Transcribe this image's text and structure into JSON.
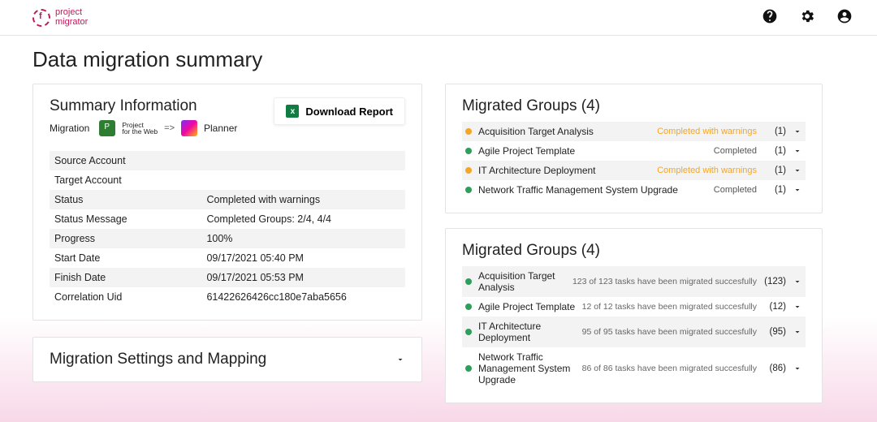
{
  "brand": {
    "line1": "project",
    "line2": "migrator"
  },
  "pageTitle": "Data migration summary",
  "summary": {
    "title": "Summary Information",
    "downloadLabel": "Download Report",
    "migrationLabel": "Migration",
    "sourceApp": "Project for the Web",
    "targetApp": "Planner",
    "rows": [
      {
        "k": "Source Account",
        "v": ""
      },
      {
        "k": "Target Account",
        "v": ""
      },
      {
        "k": "Status",
        "v": "Completed with warnings"
      },
      {
        "k": "Status Message",
        "v": "Completed Groups: 2/4, 4/4"
      },
      {
        "k": "Progress",
        "v": "100%"
      },
      {
        "k": "Start Date",
        "v": "09/17/2021 05:40 PM"
      },
      {
        "k": "Finish Date",
        "v": "09/17/2021 05:53 PM"
      },
      {
        "k": "Correlation Uid",
        "v": "61422626426cc180e7aba5656"
      }
    ]
  },
  "settings": {
    "title": "Migration Settings and Mapping"
  },
  "groups1": {
    "title": "Migrated Groups (4)",
    "items": [
      {
        "dot": "orange",
        "name": "Acquisition Target Analysis",
        "status": "Completed with warnings",
        "statusClass": "warn",
        "count": "(1)",
        "shade": true
      },
      {
        "dot": "green",
        "name": "Agile Project Template",
        "status": "Completed",
        "statusClass": "ok",
        "count": "(1)",
        "shade": false
      },
      {
        "dot": "orange",
        "name": "IT Architecture Deployment",
        "status": "Completed with warnings",
        "statusClass": "warn",
        "count": "(1)",
        "shade": true
      },
      {
        "dot": "green",
        "name": "Network Traffic Management System Upgrade",
        "status": "Completed",
        "statusClass": "ok",
        "count": "(1)",
        "shade": false
      }
    ]
  },
  "groups2": {
    "title": "Migrated Groups (4)",
    "items": [
      {
        "dot": "green",
        "name": "Acquisition Target Analysis",
        "status": "123 of 123 tasks have been migrated succesfully",
        "statusClass": "msg",
        "count": "(123)",
        "shade": true
      },
      {
        "dot": "green",
        "name": "Agile Project Template",
        "status": "12 of 12 tasks have been migrated succesfully",
        "statusClass": "msg",
        "count": "(12)",
        "shade": false
      },
      {
        "dot": "green",
        "name": "IT Architecture Deployment",
        "status": "95 of 95 tasks have been migrated succesfully",
        "statusClass": "msg",
        "count": "(95)",
        "shade": true
      },
      {
        "dot": "green",
        "name": "Network Traffic Management System Upgrade",
        "status": "86 of 86 tasks have been migrated succesfully",
        "statusClass": "msg",
        "count": "(86)",
        "shade": false
      }
    ]
  }
}
